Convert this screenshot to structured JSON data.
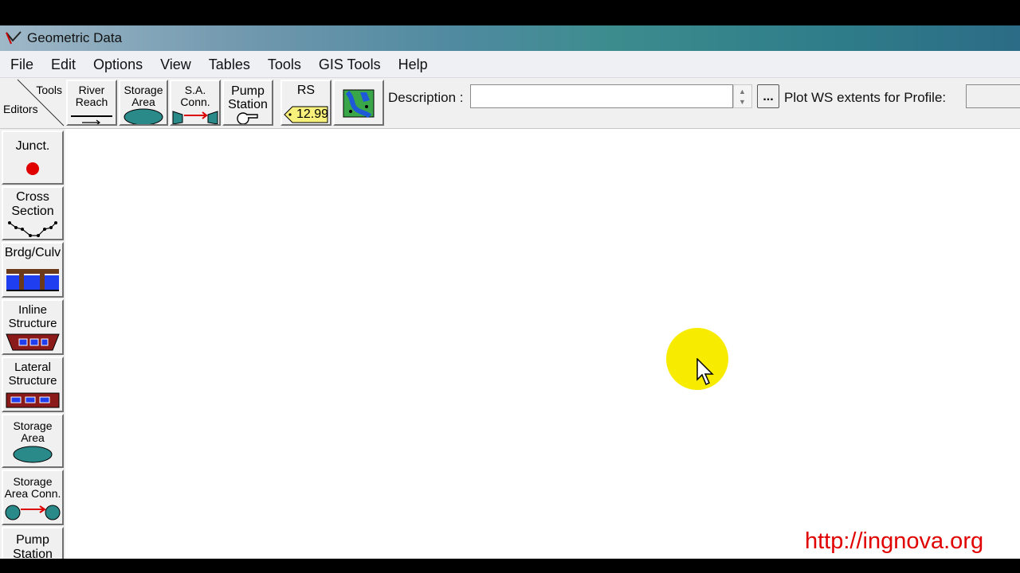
{
  "window": {
    "title": "Geometric Data"
  },
  "menu": [
    "File",
    "Edit",
    "Options",
    "View",
    "Tables",
    "Tools",
    "GIS Tools",
    "Help"
  ],
  "toolbar": {
    "tools_label": "Tools",
    "editors_label": "Editors",
    "buttons": [
      {
        "label": "River\nReach",
        "icon": "river-reach-icon"
      },
      {
        "label": "Storage\nArea",
        "icon": "storage-area-icon"
      },
      {
        "label": "S.A.\nConn.",
        "icon": "sa-connection-icon"
      },
      {
        "label": "Pump\nStation",
        "icon": "pump-station-icon"
      },
      {
        "label": "RS",
        "tag": "12.99",
        "icon": "river-station-tag-icon"
      },
      {
        "label": "",
        "icon": "background-map-icon"
      }
    ],
    "description_label": "Description :",
    "description_value": "",
    "ellipsis_label": "...",
    "plot_ws_label": "Plot WS extents for Profile:",
    "profile_value": ""
  },
  "editors": [
    {
      "label": "Junct.",
      "icon": "junction-icon"
    },
    {
      "label": "Cross\nSection",
      "icon": "cross-section-icon"
    },
    {
      "label": "Brdg/Culv",
      "icon": "bridge-culvert-icon"
    },
    {
      "label": "Inline\nStructure",
      "icon": "inline-structure-icon"
    },
    {
      "label": "Lateral\nStructure",
      "icon": "lateral-structure-icon"
    },
    {
      "label": "Storage\nArea",
      "icon": "storage-area-icon"
    },
    {
      "label": "Storage\nArea Conn.",
      "icon": "storage-area-conn-icon"
    },
    {
      "label": "Pump\nStation",
      "icon": "pump-station-icon"
    }
  ],
  "watermark": "http://ingnova.org",
  "colors": {
    "storage": "#2a8a8a",
    "junction": "#e00000",
    "bridge_water": "#1e3ef0",
    "structure": "#8b1a1a",
    "highlight": "#f7ec00"
  }
}
